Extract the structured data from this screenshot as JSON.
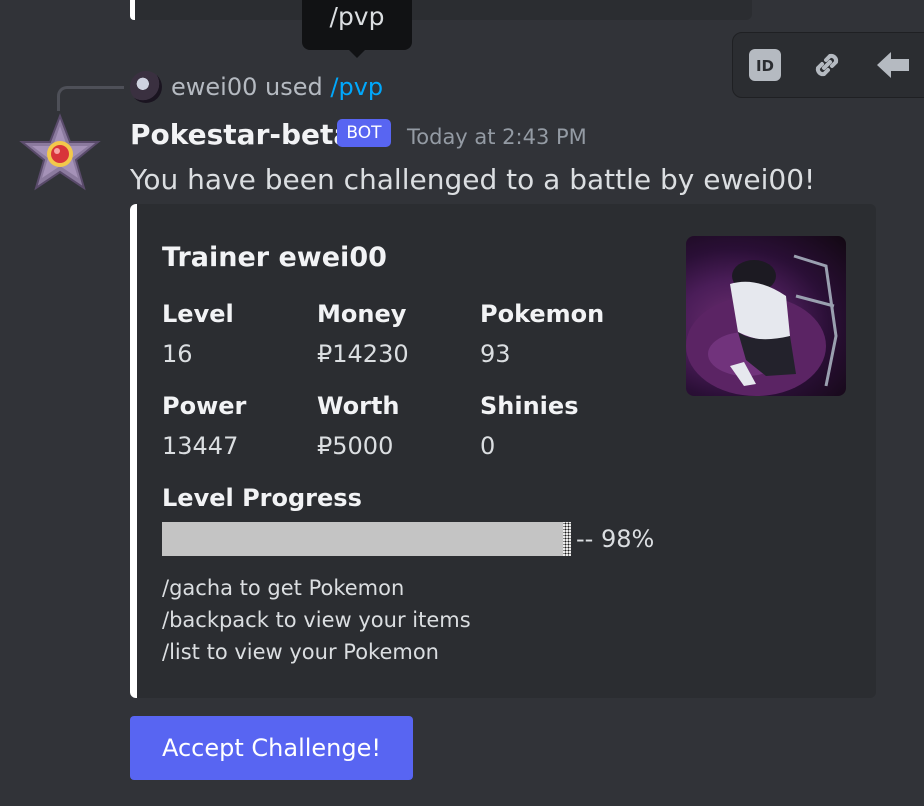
{
  "tooltip": {
    "text": "/pvp"
  },
  "toolbar": {
    "id_icon": "id-card-icon",
    "link_icon": "link-icon",
    "reply_icon": "reply-arrow-icon",
    "id_label": "ID"
  },
  "reply": {
    "username": "ewei00",
    "verb": "used",
    "command": "/pvp"
  },
  "message": {
    "author": "Pokestar-beta",
    "bot_tag": "BOT",
    "timestamp": "Today at 2:43 PM",
    "content": "You have been challenged to a battle by ewei00!"
  },
  "embed": {
    "accent": "#ffffff",
    "title": "Trainer ewei00",
    "fields": [
      {
        "name": "Level",
        "value": "16"
      },
      {
        "name": "Money",
        "value": "₽14230"
      },
      {
        "name": "Pokemon",
        "value": "93"
      },
      {
        "name": "Power",
        "value": "13447"
      },
      {
        "name": "Worth",
        "value": "₽5000"
      },
      {
        "name": "Shinies",
        "value": "0"
      }
    ],
    "progress": {
      "label": "Level Progress",
      "percent": 98,
      "text": "-- 98%"
    },
    "footer_lines": [
      "/gacha to get Pokemon",
      "/backpack to view your items",
      "/list to view your Pokemon"
    ]
  },
  "button": {
    "label": "Accept Challenge!",
    "color": "#5865f2"
  },
  "colors": {
    "background": "#313338",
    "embed_bg": "#2b2d31",
    "link": "#00a8fc",
    "blurple": "#5865f2"
  }
}
